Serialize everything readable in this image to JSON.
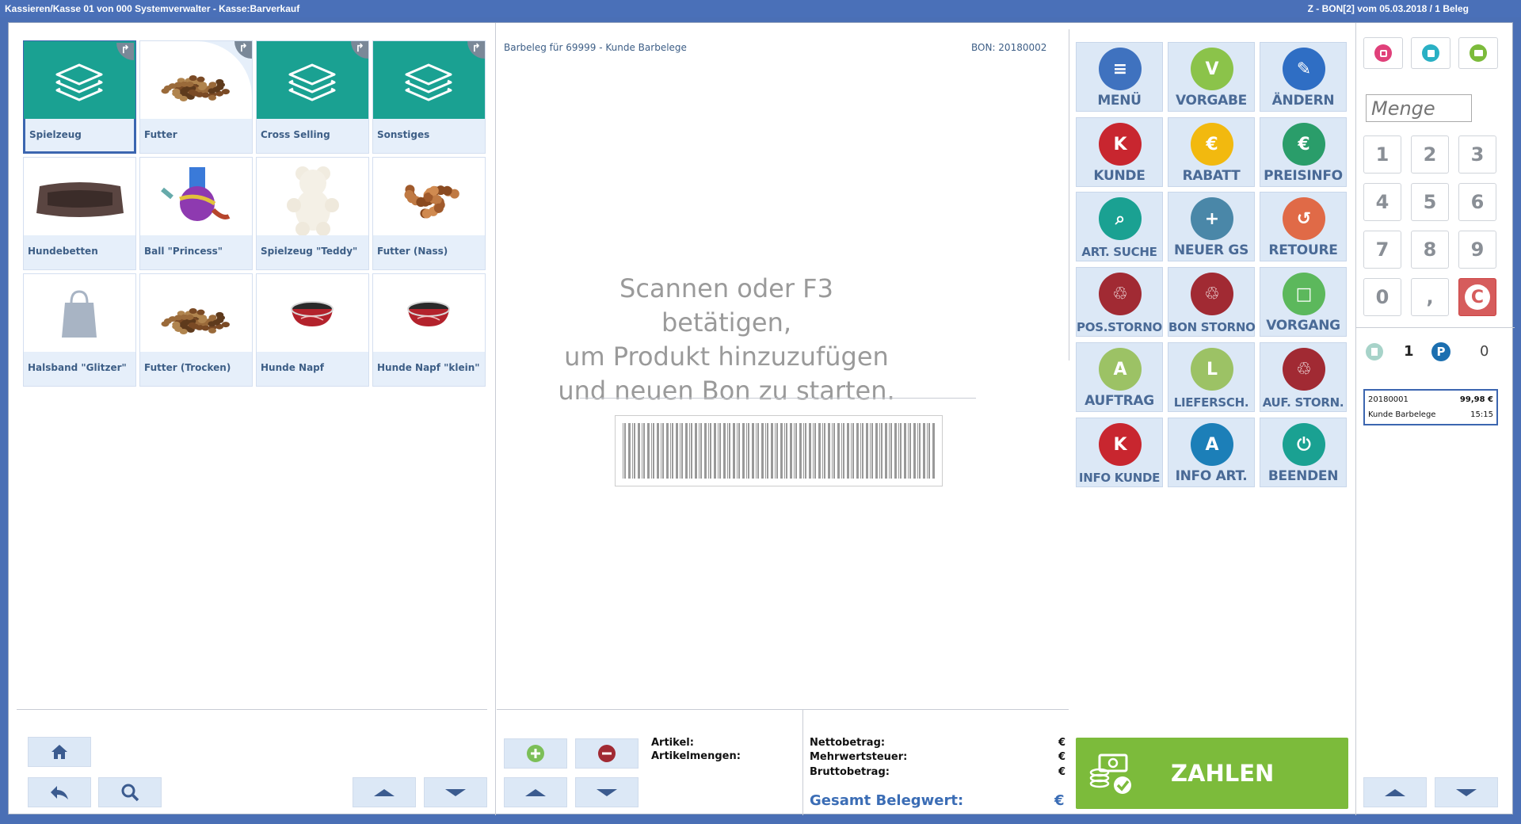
{
  "window": {
    "title": "Kassieren/Kasse 01 von 000 Systemverwalter - Kasse:Barverkauf",
    "status_right": "Z - BON[2] vom 05.03.2018 / 1 Beleg"
  },
  "tiles": [
    {
      "label": "Spielzeug",
      "icon": "layers-icon",
      "kind": "category",
      "selected": true
    },
    {
      "label": "Futter",
      "icon": "kibble-image",
      "kind": "category"
    },
    {
      "label": "Cross Selling",
      "icon": "layers-icon",
      "kind": "category"
    },
    {
      "label": "Sonstiges",
      "icon": "layers-icon",
      "kind": "category"
    },
    {
      "label": "Hundebetten",
      "icon": "dog-bed-image"
    },
    {
      "label": "Ball \"Princess\"",
      "icon": "ball-toy-image"
    },
    {
      "label": "Spielzeug \"Teddy\"",
      "icon": "teddy-image"
    },
    {
      "label": "Futter (Nass)",
      "icon": "wet-food-image"
    },
    {
      "label": "Halsband \"Glitzer\"",
      "icon": "bag-placeholder-icon"
    },
    {
      "label": "Futter (Trocken)",
      "icon": "kibble-image"
    },
    {
      "label": "Hunde Napf",
      "icon": "dog-bowl-image"
    },
    {
      "label": "Hunde Napf \"klein\"",
      "icon": "dog-bowl-image"
    }
  ],
  "receipt": {
    "header_left": "Barbeleg für 69999 - Kunde Barbelege",
    "header_right": "BON: 20180002",
    "empty_line1": "Scannen oder F3 betätigen,",
    "empty_line2": "um Produkt hinzuzufügen",
    "empty_line3": "und neuen Bon zu starten."
  },
  "counts": {
    "artikel_label": "Artikel:",
    "artikelmengen_label": "Artikelmengen:"
  },
  "totals": {
    "netto_label": "Nettobetrag:",
    "mwst_label": "Mehrwertsteuer:",
    "brutto_label": "Bruttobetrag:",
    "currency": "€",
    "gesamt_label": "Gesamt Belegwert:"
  },
  "functions": [
    {
      "label": "MENÜ",
      "icon": "menu-icon",
      "color": "#3f72bf"
    },
    {
      "label": "VORGABE",
      "icon": "vorgabe-icon",
      "color": "#8bc34a"
    },
    {
      "label": "ÄNDERN",
      "icon": "pencil-icon",
      "color": "#2f6ec4"
    },
    {
      "label": "KUNDE",
      "icon": "customer-k-icon",
      "color": "#c8262f"
    },
    {
      "label": "RABATT",
      "icon": "discount-icon",
      "color": "#f2b90f"
    },
    {
      "label": "PREISINFO",
      "icon": "price-info-icon",
      "color": "#2a9d6a"
    },
    {
      "label": "ART. SUCHE",
      "icon": "article-search-icon",
      "color": "#1aa192"
    },
    {
      "label": "NEUER GS",
      "icon": "voucher-icon",
      "color": "#4a87a8"
    },
    {
      "label": "RETOURE",
      "icon": "return-icon",
      "color": "#e06a47"
    },
    {
      "label": "POS.STORNO",
      "icon": "trash-icon",
      "color": "#a12a33"
    },
    {
      "label": "BON STORNO",
      "icon": "trash-receipt-icon",
      "color": "#a12a33"
    },
    {
      "label": "VORGANG",
      "icon": "document-icon",
      "color": "#5cb85c"
    },
    {
      "label": "AUFTRAG",
      "icon": "order-icon",
      "color": "#9cc265"
    },
    {
      "label": "LIEFERSCH.",
      "icon": "delivery-note-icon",
      "color": "#9cc265"
    },
    {
      "label": "AUF. STORN.",
      "icon": "trash-order-icon",
      "color": "#a12a33"
    },
    {
      "label": "INFO KUNDE",
      "icon": "customer-info-icon",
      "color": "#c8262f"
    },
    {
      "label": "INFO ART.",
      "icon": "article-info-icon",
      "color": "#1c7fb8"
    },
    {
      "label": "BEENDEN",
      "icon": "power-icon",
      "color": "#1aa192"
    }
  ],
  "pay": {
    "label": "ZAHLEN",
    "color": "#7cbb3b"
  },
  "keypad": {
    "menge_placeholder": "Menge",
    "keys": [
      "1",
      "2",
      "3",
      "4",
      "5",
      "6",
      "7",
      "8",
      "9",
      "0",
      ",",
      "C"
    ]
  },
  "parked": {
    "count_receipts": "1",
    "count_parked": "0",
    "bon_number": "20180001",
    "amount": "99,98 €",
    "customer": "Kunde Barbelege",
    "time": "15:15"
  }
}
